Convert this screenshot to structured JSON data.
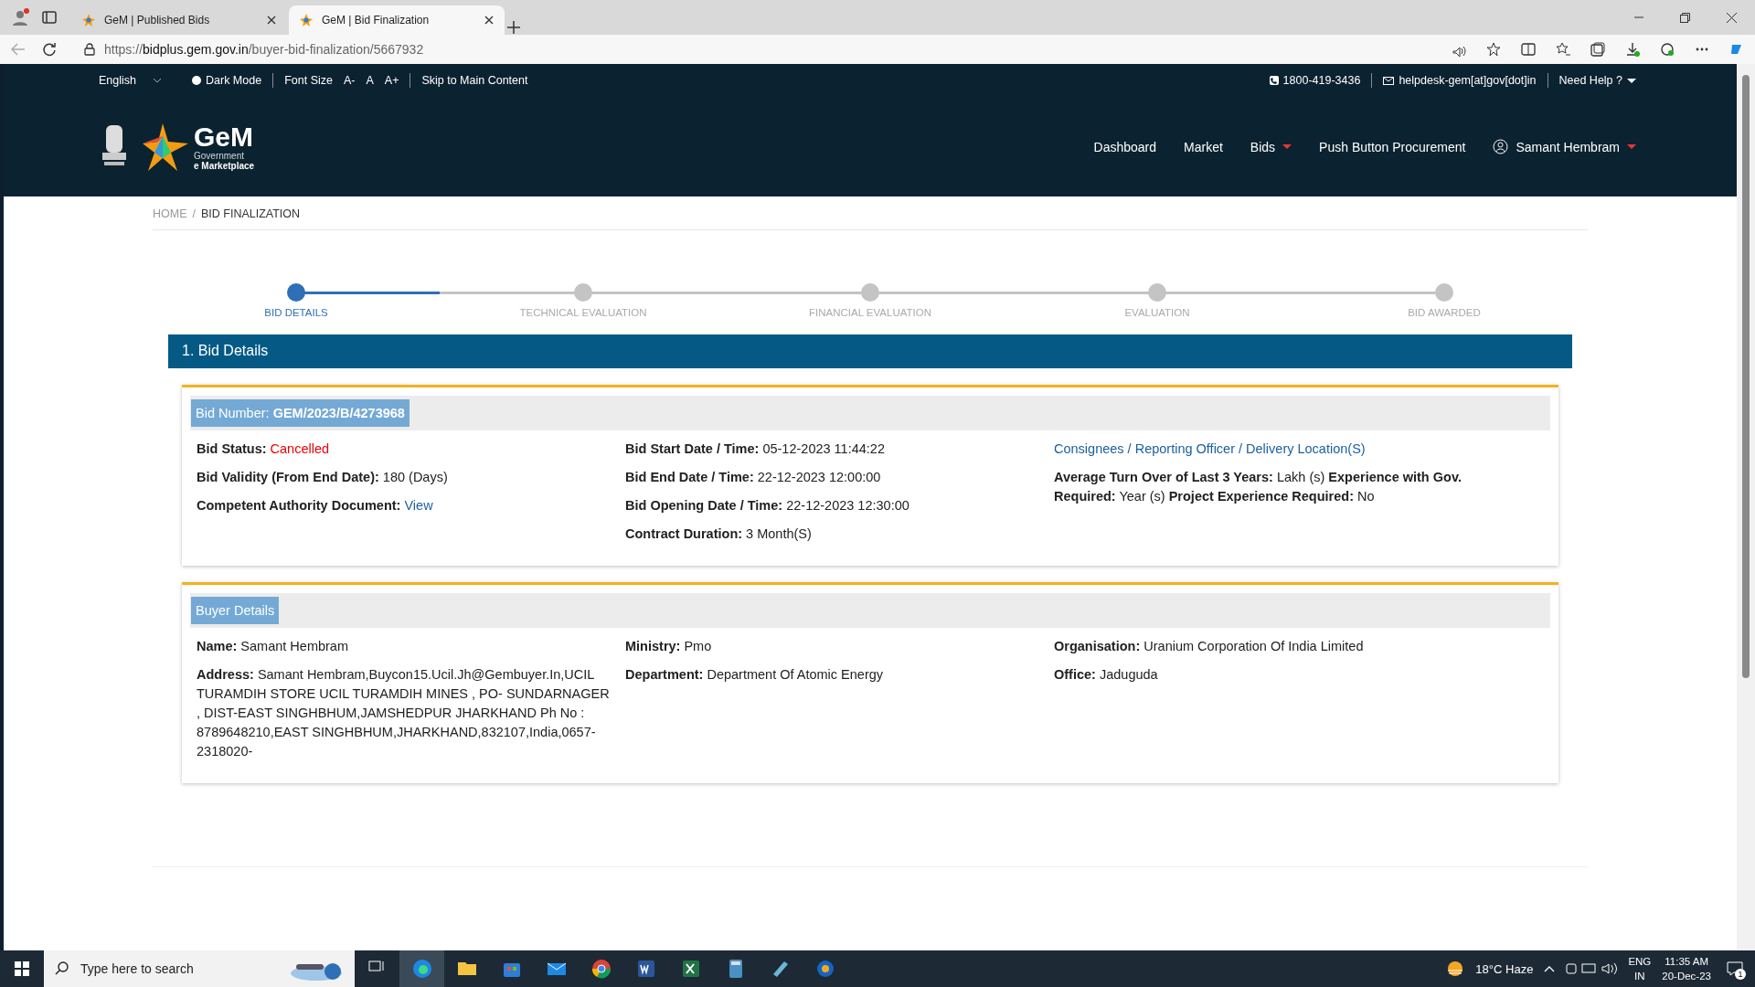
{
  "browser": {
    "tabs": [
      {
        "title": "GeM | Published Bids",
        "selected": false
      },
      {
        "title": "GeM | Bid Finalization",
        "selected": true
      }
    ],
    "url": "https://**bidplus.gem.gov.in**/buyer-bid-finalization/5667932"
  },
  "topbar": {
    "language": "English",
    "dark_mode": "Dark Mode",
    "font_size_label": "Font Size",
    "font_buttons": [
      "A-",
      "A",
      "A+"
    ],
    "skip_link": "Skip to Main Content",
    "phone": "1800-419-3436",
    "email": "helpdesk-gem[at]gov[dot]in",
    "help": "Need Help ?"
  },
  "logo": {
    "name": "GeM",
    "line1": "Government",
    "line2": "e Marketplace"
  },
  "nav": [
    {
      "label": "Dashboard",
      "dropdown": false
    },
    {
      "label": "Market",
      "dropdown": false
    },
    {
      "label": "Bids",
      "dropdown": true
    },
    {
      "label": "Push Button Procurement",
      "dropdown": false
    }
  ],
  "user": {
    "name": "Samant Hembram",
    "dropdown": true
  },
  "breadcrumb": [
    {
      "label": "HOME",
      "current": false
    },
    {
      "label": "BID FINALIZATION",
      "current": true
    }
  ],
  "breadcrumb_separator": "/",
  "steps": [
    {
      "label": "BID DETAILS",
      "selected": true
    },
    {
      "label": "TECHNICAL EVALUATION",
      "selected": false
    },
    {
      "label": "FINANCIAL EVALUATION",
      "selected": false
    },
    {
      "label": "EVALUATION",
      "selected": false
    },
    {
      "label": "BID AWARDED",
      "selected": false
    }
  ],
  "section_title": "1. Bid Details",
  "cards": [
    {
      "heading": {
        "label": "Bid Number:",
        "value": "GEM/2023/B/4273968"
      },
      "columns": [
        [
          {
            "kind": "status",
            "label": "Bid Status:",
            "value": "Cancelled"
          },
          {
            "kind": "text",
            "label": "Bid Validity (From End Date):",
            "value": "180 (Days)"
          },
          {
            "kind": "link",
            "label": "Competent Authority Document:",
            "value": "View"
          }
        ],
        [
          {
            "kind": "text",
            "label": "Bid Start Date / Time:",
            "value": "05-12-2023 11:44:22"
          },
          {
            "kind": "text",
            "label": "Bid End Date / Time:",
            "value": "22-12-2023 12:00:00"
          },
          {
            "kind": "text",
            "label": "Bid Opening Date / Time:",
            "value": "22-12-2023 12:30:00"
          },
          {
            "kind": "text",
            "label": "Contract Duration:",
            "value": " 3 Month(S)"
          }
        ],
        [
          {
            "kind": "standalone_link",
            "value": "Consignees / Reporting Officer / Delivery Location(S)"
          },
          {
            "kind": "rich",
            "value": "**Average Turn Over of Last 3 Years:** Lakh (s) **Experience with Gov. Required:** Year (s) **Project Experience Required:** No"
          }
        ]
      ]
    },
    {
      "heading": {
        "label": "Buyer Details"
      },
      "columns": [
        [
          {
            "kind": "text",
            "label": "Name:",
            "value": "Samant Hembram"
          },
          {
            "kind": "text",
            "label": "Address:",
            "value": "Samant Hembram,Buycon15.Ucil.Jh@Gembuyer.In,UCIL TURAMDIH STORE UCIL TURAMDIH MINES , PO- SUNDARNAGER , DIST-EAST SINGHBHUM,JAMSHEDPUR JHARKHAND Ph No : 8789648210,EAST SINGHBHUM,JHARKHAND,832107,India,0657-2318020-"
          }
        ],
        [
          {
            "kind": "text",
            "label": "Ministry:",
            "value": "Pmo"
          },
          {
            "kind": "text",
            "label": "Department:",
            "value": "Department Of Atomic Energy"
          }
        ],
        [
          {
            "kind": "text",
            "label": "Organisation:",
            "value": "Uranium Corporation Of India Limited"
          },
          {
            "kind": "text",
            "label": "Office:",
            "value": "Jaduguda"
          }
        ]
      ]
    }
  ],
  "taskbar": {
    "search_placeholder": "Type here to search",
    "weather": "18°C  Haze",
    "lang": "ENG",
    "region": "IN",
    "time": "11:35 AM",
    "date": "20-Dec-23",
    "notifications": "1"
  }
}
